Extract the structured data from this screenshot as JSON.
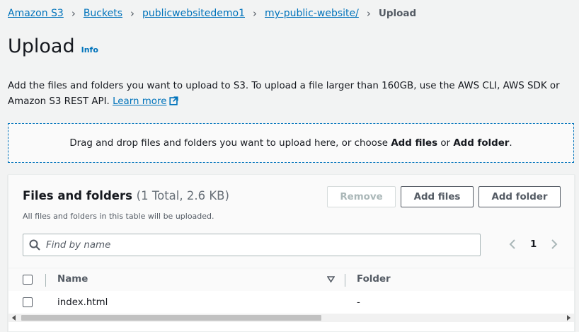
{
  "breadcrumb": {
    "items": [
      "Amazon S3",
      "Buckets",
      "publicwebsitedemo1",
      "my-public-website/"
    ],
    "current": "Upload"
  },
  "page": {
    "title": "Upload",
    "info_label": "Info",
    "description": "Add the files and folders you want to upload to S3. To upload a file larger than 160GB, use the AWS CLI, AWS SDK or Amazon S3 REST API.",
    "learn_more": "Learn more"
  },
  "dropzone": {
    "text_prefix": "Drag and drop files and folders you want to upload here, or choose",
    "add_files": "Add files",
    "or": "or",
    "add_folder": "Add folder",
    "suffix": "."
  },
  "panel": {
    "title": "Files and folders",
    "count": "(1 Total, 2.6 KB)",
    "subtitle": "All files and folders in this table will be uploaded.",
    "remove_label": "Remove",
    "add_files_label": "Add files",
    "add_folder_label": "Add folder",
    "search_placeholder": "Find by name",
    "page_number": "1",
    "columns": [
      "Name",
      "Folder"
    ],
    "rows": [
      {
        "name": "index.html",
        "folder": "-"
      }
    ]
  },
  "icons": {
    "external": "external-link-icon",
    "search": "search-icon",
    "prev": "chevron-left-icon",
    "next": "chevron-right-icon",
    "sort": "sort-down-icon"
  },
  "colors": {
    "link": "#0073bb",
    "text": "#16191f",
    "muted": "#545b64",
    "background": "#f2f3f3"
  }
}
